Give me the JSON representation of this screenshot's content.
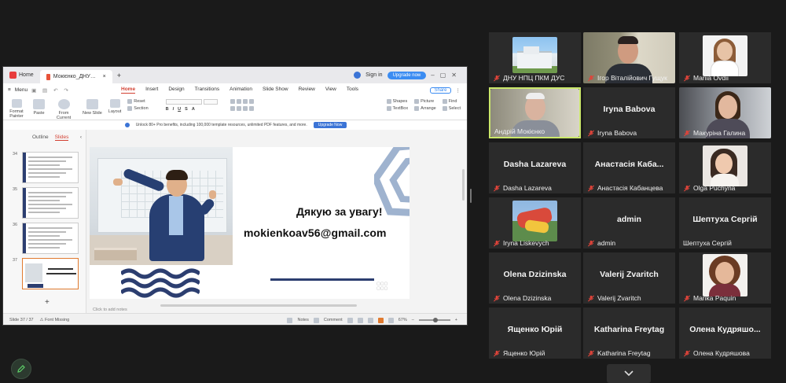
{
  "wps": {
    "home_tab": "Home",
    "doc_tab": "Мокієнко_ДНУНПЦПКМ.pptx",
    "sign_in": "Sign in",
    "upgrade": "Upgrade now",
    "menu": "Menu",
    "ribbon_tabs": [
      "Home",
      "Insert",
      "Design",
      "Transitions",
      "Animation",
      "Slide Show",
      "Review",
      "View",
      "Tools"
    ],
    "share": "Share",
    "ribbon": {
      "format_painter": "Format Painter",
      "paste": "Paste",
      "from_current_slide": "From Current Slide",
      "new_slide": "New Slide",
      "layout": "Layout",
      "reset": "Reset",
      "section": "Section",
      "shapes": "Shapes",
      "textbox": "TextBox",
      "picture": "Picture",
      "arrange": "Arrange",
      "find": "Find",
      "select": "Select"
    },
    "promo_text": "Unlock 80+ Pro benefits, including 100,000 template resources, unlimited PDF features, and more.",
    "promo_btn": "Upgrade Now",
    "panel_tab_outline": "Outline",
    "panel_tab_slides": "Slides",
    "thumb_nums": [
      "34",
      "35",
      "36",
      "37"
    ],
    "slide_thanks": "Дякую за увагу!",
    "slide_email": "mokienkoav56@gmail.com",
    "notes_placeholder": "Click to add notes",
    "status_slide": "Slide 37 / 37",
    "status_font": "Font Missing",
    "status_notes": "Notes",
    "status_comment": "Comment",
    "zoom": "67%"
  },
  "participants": [
    {
      "name": "ДНУ НПЦ ПКМ ДУС",
      "video": "building",
      "muted": true
    },
    {
      "name": "Ігор Віталійович Гущук",
      "video": "man1",
      "muted": true
    },
    {
      "name": "Mariia Ovdii",
      "video": "woman1",
      "muted": true
    },
    {
      "name": "Андрій Мокієнко",
      "video": "man2",
      "muted": false,
      "active": true
    },
    {
      "name": "Iryna Babova",
      "big": "Iryna Babova",
      "muted": true
    },
    {
      "name": "Макуріна Галина",
      "video": "woman2",
      "muted": true
    },
    {
      "name": "Dasha Lazareva",
      "big": "Dasha Lazareva",
      "muted": true
    },
    {
      "name": "Анастасія Кабанцева",
      "big": "Анастасія Каба...",
      "muted": true
    },
    {
      "name": "Olga Puchyna",
      "video": "olga",
      "muted": true
    },
    {
      "name": "Iryna Liskevych",
      "video": "art",
      "muted": true
    },
    {
      "name": "admin",
      "big": "admin",
      "muted": true
    },
    {
      "name": "Шептуха Сергій",
      "big": "Шептуха Сергій",
      "muted": false
    },
    {
      "name": "Olena Dzizinska",
      "big": "Olena Dzizinska",
      "muted": true
    },
    {
      "name": "Valerij Zvaritch",
      "big": "Valerij Zvaritch",
      "muted": true
    },
    {
      "name": "Marika Paquin",
      "video": "marika",
      "muted": true
    },
    {
      "name": "Ященко Юрій",
      "big": "Ященко Юрій",
      "muted": true
    },
    {
      "name": "Katharina Freytag",
      "big": "Katharina Freytag",
      "muted": true
    },
    {
      "name": "Олена Кудряшова",
      "big": "Олена Кудряшо...",
      "muted": true
    }
  ],
  "colors": {
    "active_border": "#cbe86b",
    "mute_red": "#e0443a",
    "wps_accent": "#d23f31"
  },
  "icons": {
    "pen": "pencil-icon",
    "chevron": "chevron-down-icon",
    "mic_off": "mic-off-icon"
  }
}
